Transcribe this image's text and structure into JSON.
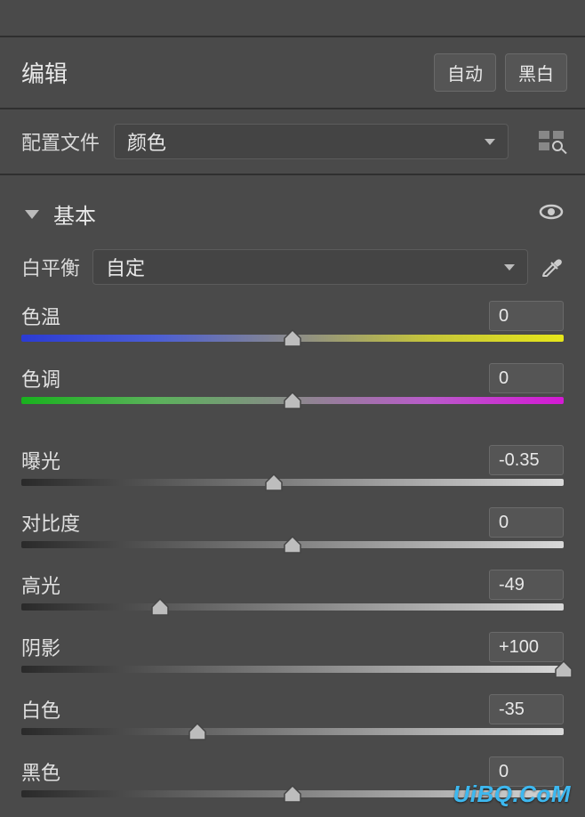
{
  "header": {
    "title": "编辑",
    "auto_label": "自动",
    "bw_label": "黑白"
  },
  "profile": {
    "label": "配置文件",
    "value": "颜色"
  },
  "section": {
    "title": "基本"
  },
  "white_balance": {
    "label": "白平衡",
    "value": "自定"
  },
  "sliders": {
    "temperature": {
      "label": "色温",
      "value": "0",
      "pos": 50
    },
    "tint": {
      "label": "色调",
      "value": "0",
      "pos": 50
    },
    "exposure": {
      "label": "曝光",
      "value": "-0.35",
      "pos": 46.5
    },
    "contrast": {
      "label": "对比度",
      "value": "0",
      "pos": 50
    },
    "highlights": {
      "label": "高光",
      "value": "-49",
      "pos": 25.5
    },
    "shadows": {
      "label": "阴影",
      "value": "+100",
      "pos": 100
    },
    "whites": {
      "label": "白色",
      "value": "-35",
      "pos": 32.5
    },
    "blacks": {
      "label": "黑色",
      "value": "0",
      "pos": 50
    }
  },
  "watermark": "UiBQ.CoM"
}
